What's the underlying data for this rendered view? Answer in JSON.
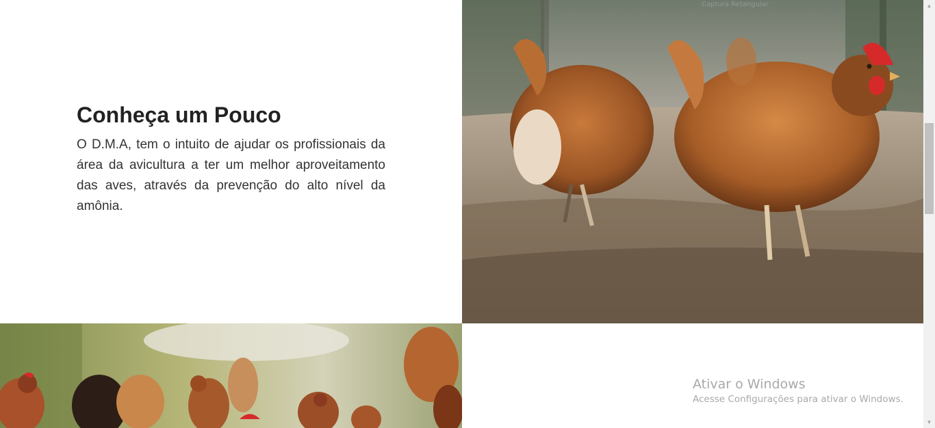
{
  "intro": {
    "heading": "Conheça um Pouco",
    "body": "O D.M.A, tem o intuito de ajudar os profissionais da área da avicultura a ter um melhor aproveitamento das aves, através da prevenção do alto nível da amônia."
  },
  "images": {
    "hens_dirt_caption": "Captura Retangular",
    "hens_dirt_icon": "photo-hens-icon",
    "hens_grass_icon": "photo-flock-icon"
  },
  "watermark": {
    "title": "Ativar o Windows",
    "subtitle": "Acesse Configurações para ativar o Windows."
  },
  "scrollbar": {
    "up_icon": "▲",
    "down_icon": "▼",
    "position_fraction": 0.29
  },
  "colors": {
    "heading": "#222222",
    "body_text": "#333333",
    "watermark": "#a8a8a8"
  }
}
